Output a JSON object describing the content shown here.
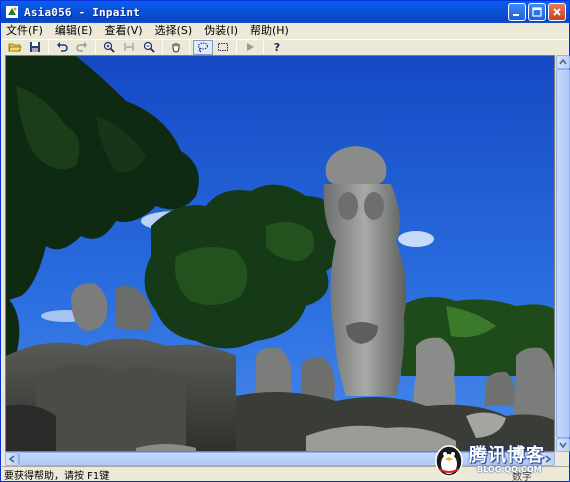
{
  "window": {
    "title": "Asia056 - Inpaint",
    "buttons": [
      "minimize",
      "maximize",
      "close"
    ]
  },
  "menu": [
    "文件(F)",
    "编辑(E)",
    "查看(V)",
    "选择(S)",
    "伪装(I)",
    "帮助(H)"
  ],
  "toolbar": {
    "icons": [
      "open-folder-icon",
      "save-icon",
      "undo-icon",
      "redo-icon",
      "zoom-in-icon",
      "fit-icon",
      "zoom-out-icon",
      "hand-icon",
      "lasso-icon",
      "marquee-icon",
      "run-icon",
      "help-icon"
    ]
  },
  "canvas": {
    "image_description": "Stone statues photo"
  },
  "status": {
    "help_text": "要获得帮助，请按 F1键",
    "right_text": "数字"
  },
  "watermark": {
    "title": "腾讯博客",
    "subtitle": "BLOG.QQ.COM"
  },
  "colors": {
    "titlebar": "#0a5ff0",
    "chrome": "#ece9d8",
    "sky": "#1f5fd2"
  }
}
